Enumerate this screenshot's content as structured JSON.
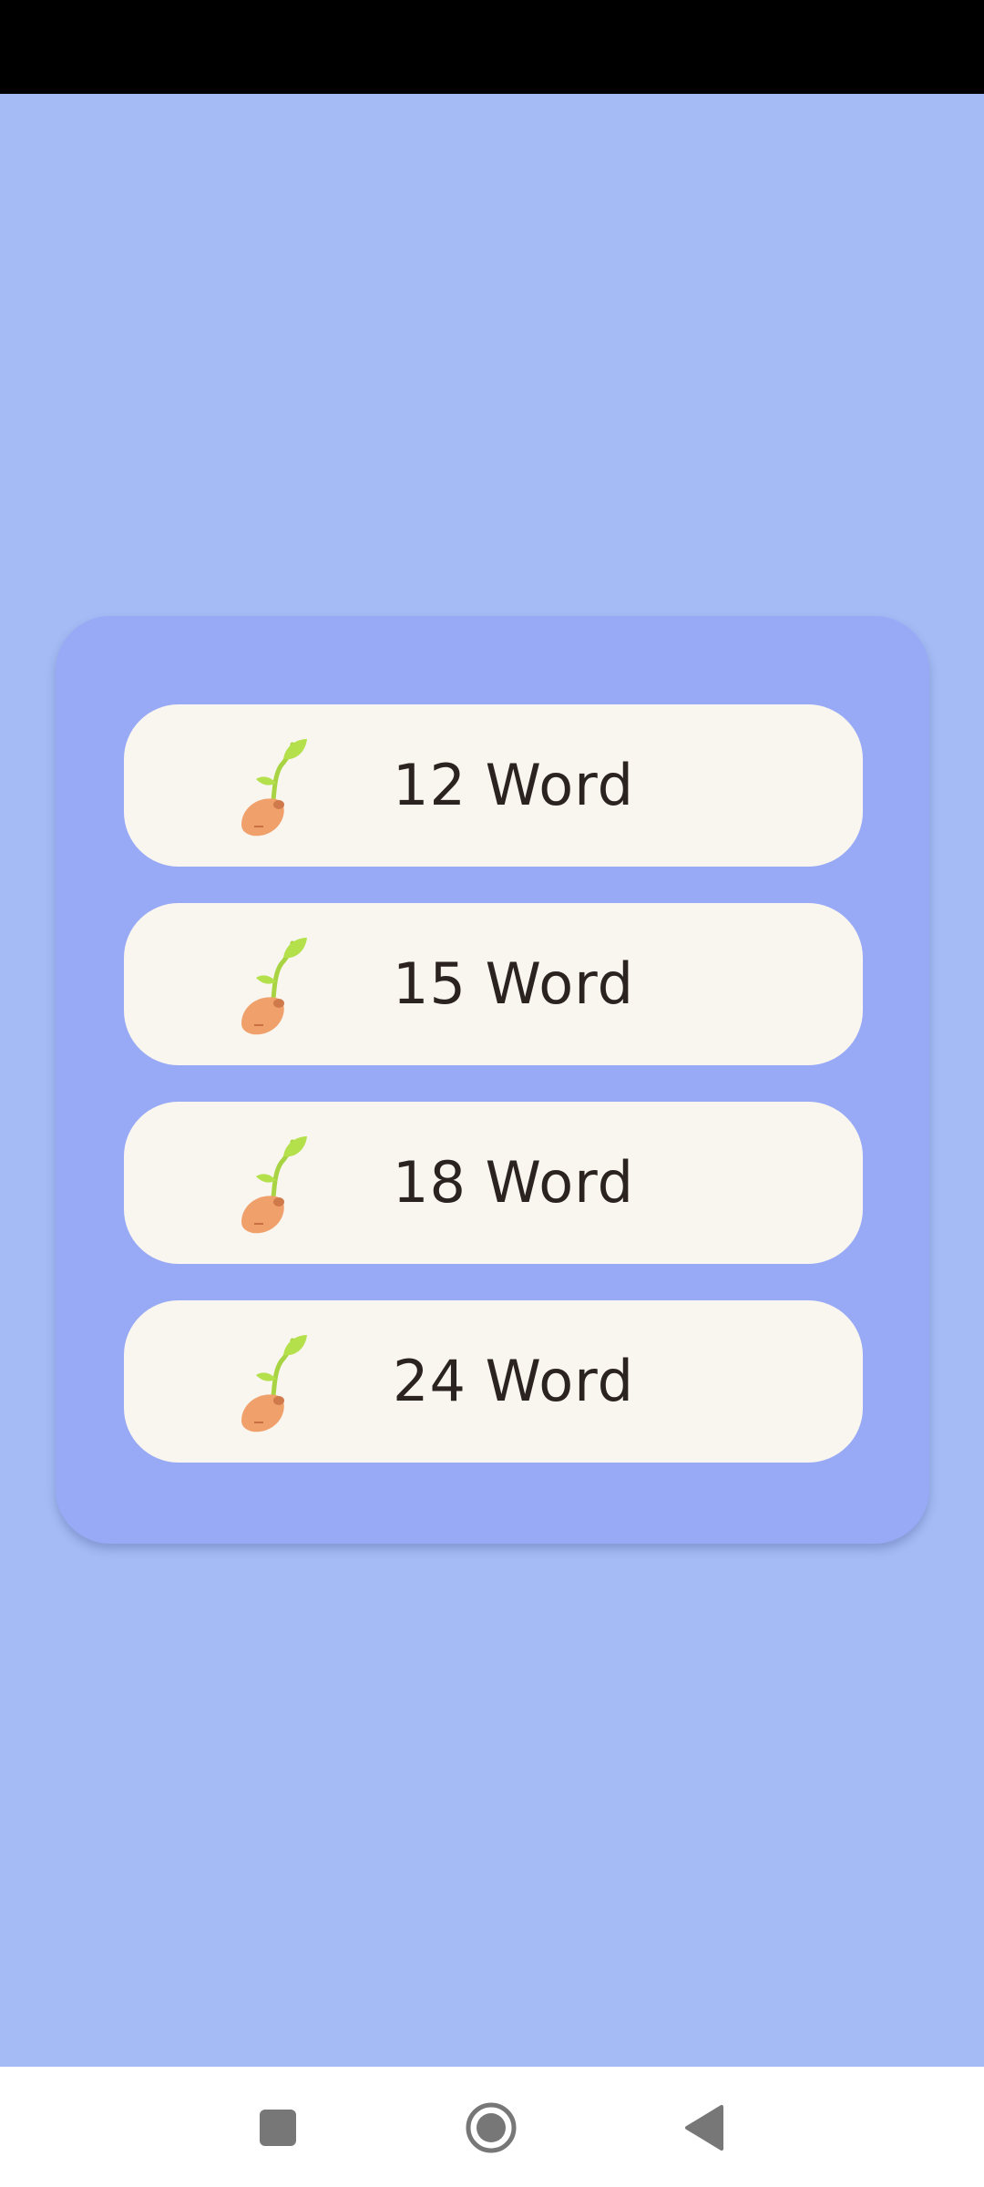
{
  "options": [
    {
      "label": "12 Word",
      "icon": "sprout-icon"
    },
    {
      "label": "15 Word",
      "icon": "sprout-icon"
    },
    {
      "label": "18 Word",
      "icon": "sprout-icon"
    },
    {
      "label": "24 Word",
      "icon": "sprout-icon"
    }
  ],
  "nav_bar": {
    "buttons": [
      "recents-square-icon",
      "home-circle-icon",
      "back-triangle-icon"
    ]
  },
  "colors": {
    "background": "#a4bbf5",
    "card": "#98aaf6",
    "option": "#f9f5ef",
    "text": "#2b2320",
    "seed": "#f0a06a",
    "leaf": "#b4e04c"
  }
}
